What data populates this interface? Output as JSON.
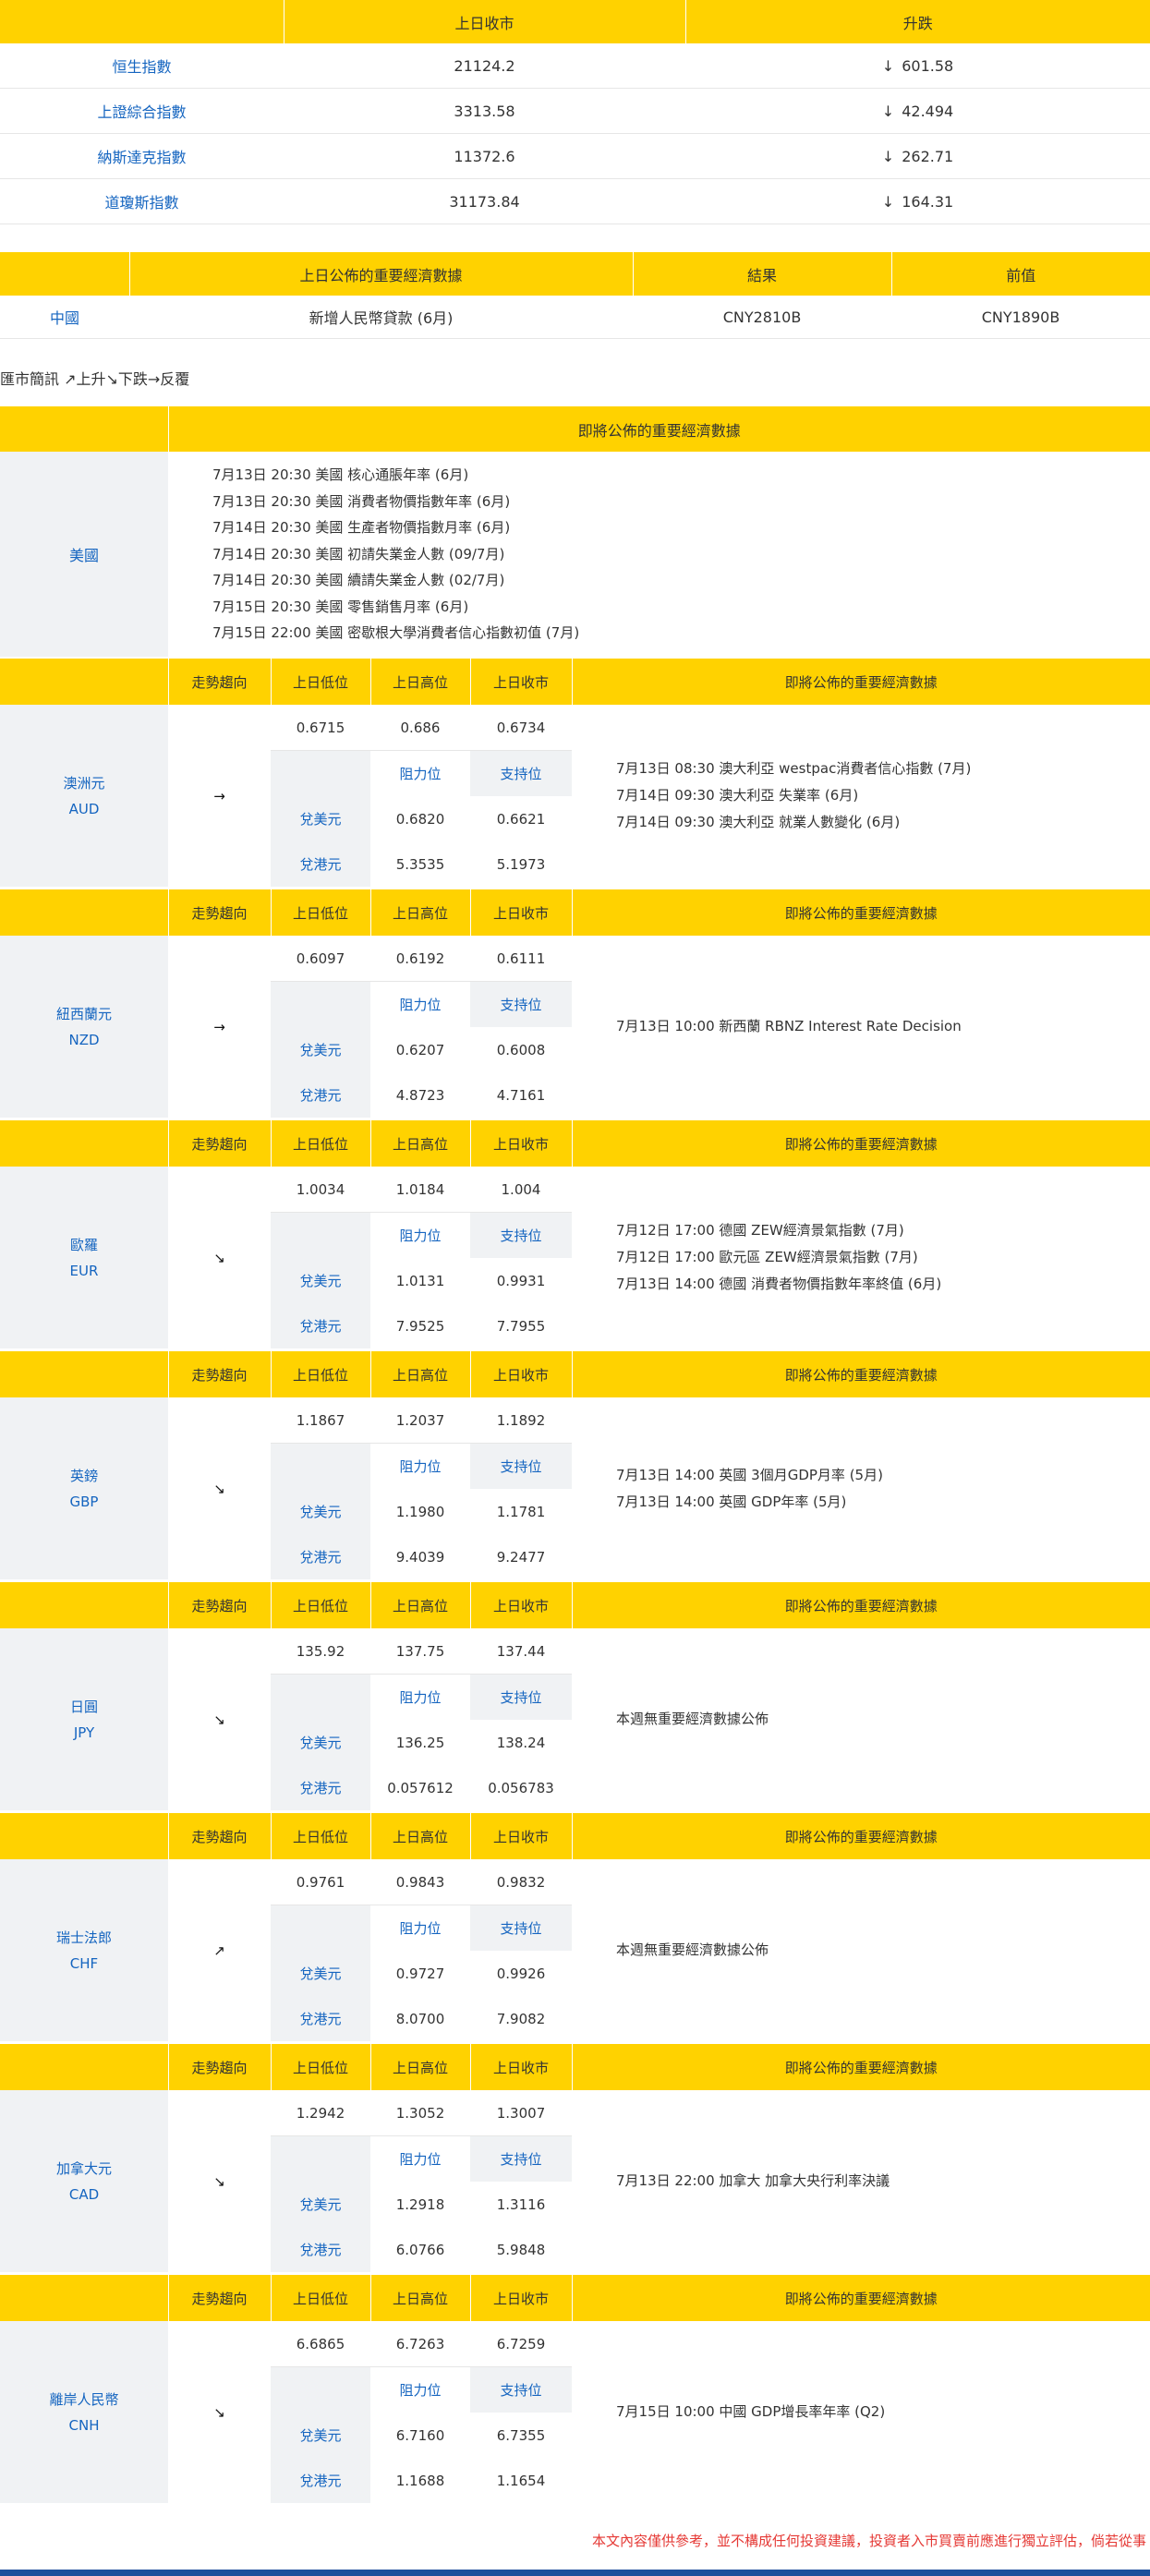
{
  "indices": {
    "headers": [
      "",
      "上日收市",
      "升跌"
    ],
    "rows": [
      {
        "name": "恒生指數",
        "close": "21124.2",
        "change": "601.58",
        "dir": "↓"
      },
      {
        "name": "上證綜合指數",
        "close": "3313.58",
        "change": "42.494",
        "dir": "↓"
      },
      {
        "name": "納斯達克指數",
        "close": "11372.6",
        "change": "262.71",
        "dir": "↓"
      },
      {
        "name": "道瓊斯指數",
        "close": "31173.84",
        "change": "164.31",
        "dir": "↓"
      }
    ]
  },
  "released": {
    "headers": [
      "",
      "上日公佈的重要經濟數據",
      "結果",
      "前值"
    ],
    "rows": [
      {
        "country": "中國",
        "item": "新增人民幣貸款 (6月)",
        "result": "CNY2810B",
        "previous": "CNY1890B"
      }
    ]
  },
  "legend": "匯市簡訊 ↗上升↘下跌→反覆",
  "upcoming": {
    "header": "即將公佈的重要經濟數據",
    "country": "美國",
    "items": [
      "7月13日 20:30  美國 核心通脹年率 (6月)",
      "7月13日 20:30  美國 消費者物價指數年率 (6月)",
      "7月14日 20:30  美國 生產者物價指數月率 (6月)",
      "7月14日 20:30  美國 初請失業金人數 (09/7月)",
      "7月14日 20:30  美國 續請失業金人數 (02/7月)",
      "7月15日 20:30  美國 零售銷售月率 (6月)",
      "7月15日 22:00  美國 密歇根大學消費者信心指數初值 (7月)"
    ]
  },
  "ccy_headers": {
    "trend": "走勢趨向",
    "low": "上日低位",
    "high": "上日高位",
    "close": "上日收市",
    "events": "即將公佈的重要經濟數據",
    "resistance": "阻力位",
    "support": "支持位",
    "vs_usd": "兌美元",
    "vs_hkd": "兌港元"
  },
  "currencies": [
    {
      "name": "澳洲元",
      "code": "AUD",
      "trend": "→",
      "low": "0.6715",
      "high": "0.686",
      "close": "0.6734",
      "usd_res": "0.6820",
      "usd_sup": "0.6621",
      "hkd_res": "5.3535",
      "hkd_sup": "5.1973",
      "events": [
        "7月13日 08:30  澳大利亞 westpac消費者信心指數 (7月)",
        "7月14日 09:30  澳大利亞 失業率 (6月)",
        "7月14日 09:30  澳大利亞 就業人數變化 (6月)"
      ]
    },
    {
      "name": "紐西蘭元",
      "code": "NZD",
      "trend": "→",
      "low": "0.6097",
      "high": "0.6192",
      "close": "0.6111",
      "usd_res": "0.6207",
      "usd_sup": "0.6008",
      "hkd_res": "4.8723",
      "hkd_sup": "4.7161",
      "events": [
        "7月13日 10:00  新西蘭 RBNZ Interest Rate Decision"
      ]
    },
    {
      "name": "歐羅",
      "code": "EUR",
      "trend": "↘",
      "low": "1.0034",
      "high": "1.0184",
      "close": "1.004",
      "usd_res": "1.0131",
      "usd_sup": "0.9931",
      "hkd_res": "7.9525",
      "hkd_sup": "7.7955",
      "events": [
        "7月12日 17:00  德國 ZEW經濟景氣指數 (7月)",
        "7月12日 17:00  歐元區 ZEW經濟景氣指數 (7月)",
        "7月13日 14:00  德國 消費者物價指數年率終值 (6月)"
      ]
    },
    {
      "name": "英鎊",
      "code": "GBP",
      "trend": "↘",
      "low": "1.1867",
      "high": "1.2037",
      "close": "1.1892",
      "usd_res": "1.1980",
      "usd_sup": "1.1781",
      "hkd_res": "9.4039",
      "hkd_sup": "9.2477",
      "events": [
        "7月13日 14:00  英國 3個月GDP月率 (5月)",
        "7月13日 14:00  英國 GDP年率 (5月)"
      ]
    },
    {
      "name": "日圓",
      "code": "JPY",
      "trend": "↘",
      "low": "135.92",
      "high": "137.75",
      "close": "137.44",
      "usd_res": "136.25",
      "usd_sup": "138.24",
      "hkd_res": "0.057612",
      "hkd_sup": "0.056783",
      "events": [
        "本週無重要經濟數據公佈"
      ]
    },
    {
      "name": "瑞士法郎",
      "code": "CHF",
      "trend": "↗",
      "low": "0.9761",
      "high": "0.9843",
      "close": "0.9832",
      "usd_res": "0.9727",
      "usd_sup": "0.9926",
      "hkd_res": "8.0700",
      "hkd_sup": "7.9082",
      "events": [
        "本週無重要經濟數據公佈"
      ]
    },
    {
      "name": "加拿大元",
      "code": "CAD",
      "trend": "↘",
      "low": "1.2942",
      "high": "1.3052",
      "close": "1.3007",
      "usd_res": "1.2918",
      "usd_sup": "1.3116",
      "hkd_res": "6.0766",
      "hkd_sup": "5.9848",
      "events": [
        "7月13日 22:00  加拿大 加拿大央行利率決議"
      ]
    },
    {
      "name": "離岸人民幣",
      "code": "CNH",
      "trend": "↘",
      "low": "6.6865",
      "high": "6.7263",
      "close": "6.7259",
      "usd_res": "6.7160",
      "usd_sup": "6.7355",
      "hkd_res": "1.1688",
      "hkd_sup": "1.1654",
      "events": [
        "7月15日 10:00  中國 GDP增長率年率 (Q2)"
      ]
    }
  ],
  "disclaimer": "本文內容僅供參考，並不構成任何投資建議，投資者入市買賣前應進行獨立評估，倘若從事",
  "colors": {
    "header": "#FFD200",
    "link": "#1565C0",
    "label_bg": "#F0F2F4",
    "disclaimer": "#E53935",
    "bottom_bar": "#1E4F9C"
  }
}
